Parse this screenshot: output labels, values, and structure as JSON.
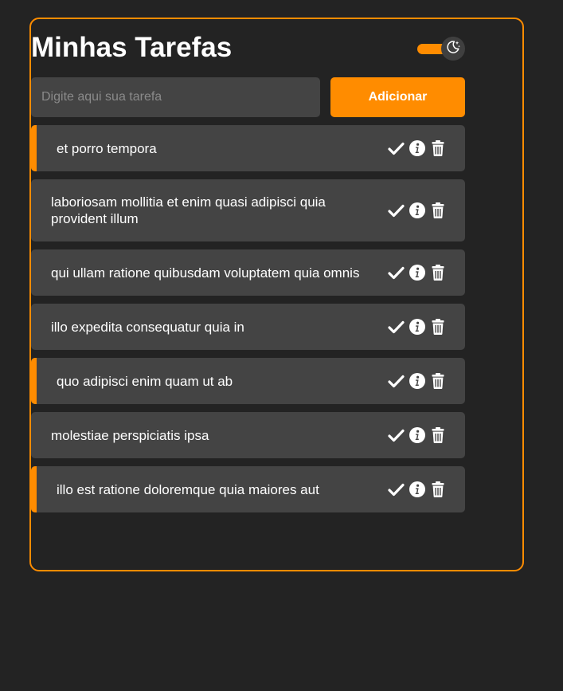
{
  "header": {
    "title": "Minhas Tarefas",
    "theme_toggle_icon": "moon-stars-icon"
  },
  "form": {
    "placeholder": "Digite aqui sua tarefa",
    "value": "",
    "add_label": "Adicionar"
  },
  "colors": {
    "background": "#232323",
    "accent": "#ff8c00",
    "task_bg": "#444444",
    "text": "#ffffff"
  },
  "tasks": [
    {
      "text": "et porro tempora",
      "highlighted": true,
      "height": 58
    },
    {
      "text": "laboriosam mollitia et enim quasi adipisci quia provident illum",
      "highlighted": false,
      "height": 78
    },
    {
      "text": "qui ullam ratione quibusdam voluptatem quia omnis",
      "highlighted": false,
      "height": 58
    },
    {
      "text": "illo expedita consequatur quia in",
      "highlighted": false,
      "height": 58
    },
    {
      "text": "quo adipisci enim quam ut ab",
      "highlighted": true,
      "height": 58
    },
    {
      "text": "molestiae perspiciatis ipsa",
      "highlighted": false,
      "height": 58
    },
    {
      "text": "illo est ratione doloremque quia maiores aut",
      "highlighted": true,
      "height": 58
    }
  ],
  "task_actions": {
    "complete_icon": "check-icon",
    "info_icon": "info-icon",
    "delete_icon": "trash-icon"
  }
}
